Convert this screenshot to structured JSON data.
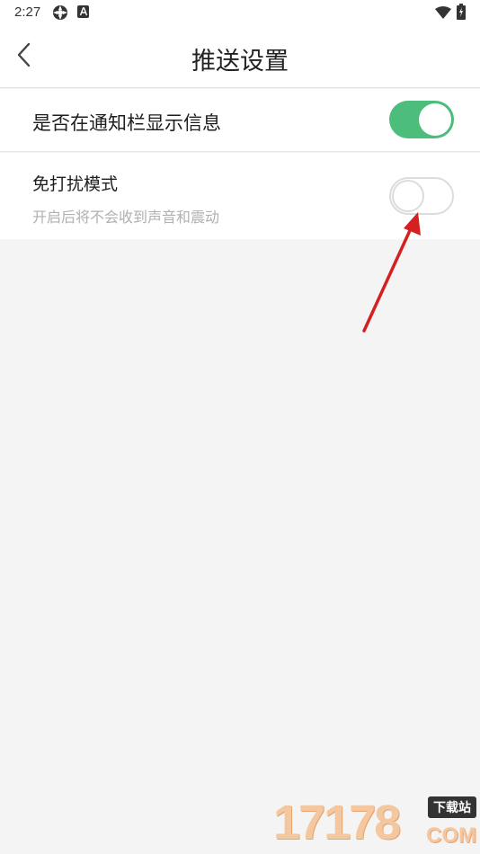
{
  "status_bar": {
    "time": "2:27",
    "icons": [
      "app-icon",
      "a-icon",
      "wifi-icon",
      "battery-icon"
    ]
  },
  "header": {
    "back_icon": "chevron-left-icon",
    "title": "推送设置"
  },
  "settings": [
    {
      "label": "是否在通知栏显示信息",
      "enabled": true
    },
    {
      "label": "免打扰模式",
      "description": "开启后将不会收到声音和震动",
      "enabled": false
    }
  ],
  "watermark": {
    "number": "17178",
    "badge": "下载站",
    "suffix": "COM"
  },
  "colors": {
    "toggle_on": "#4cbd7a",
    "toggle_off_border": "#dcdcdc",
    "annotation_arrow": "#d42020"
  }
}
